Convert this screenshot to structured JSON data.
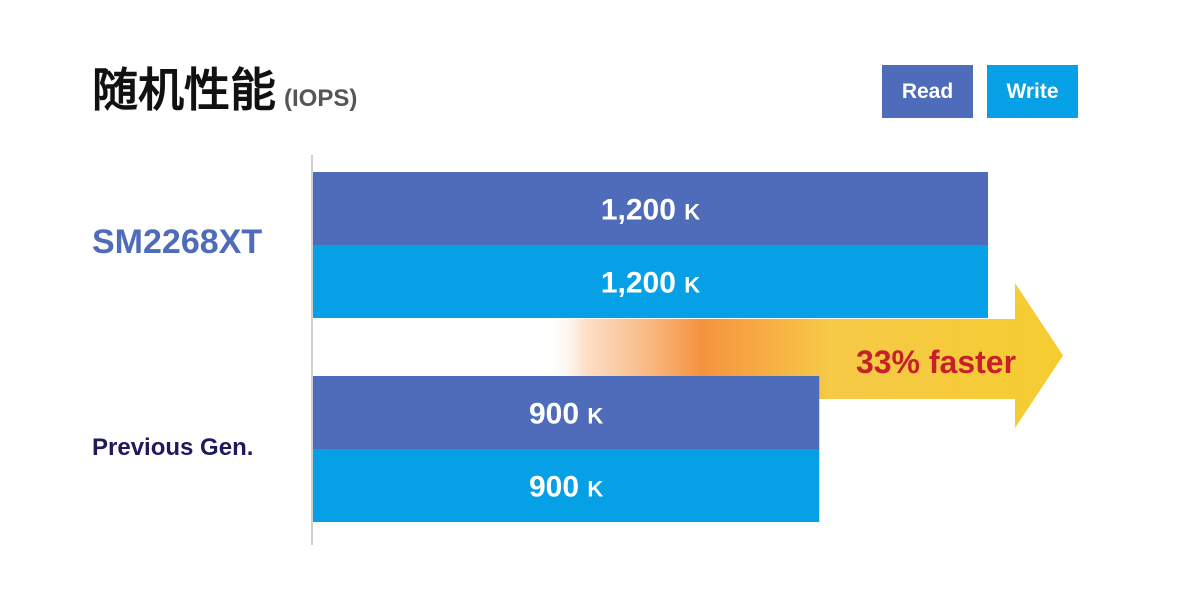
{
  "title": "随机性能",
  "title_unit": "(IOPS)",
  "legend": {
    "read_label": "Read",
    "write_label": "Write",
    "read_color": "#4e6cb9",
    "write_color": "#05a0e6"
  },
  "annotation": {
    "text": "33% faster",
    "color": "#c8202b",
    "arrow_color": "#f5cc30"
  },
  "chart_data": {
    "type": "bar",
    "orientation": "horizontal",
    "categories": [
      "SM2268XT",
      "Previous Gen."
    ],
    "series": [
      {
        "name": "Read",
        "values": [
          1200,
          900
        ],
        "labels": [
          "1,200",
          "900"
        ]
      },
      {
        "name": "Write",
        "values": [
          1200,
          900
        ],
        "labels": [
          "1,200",
          "900"
        ]
      }
    ],
    "value_unit_suffix": "K",
    "xlim": [
      0,
      1200
    ],
    "grid": false,
    "legend_position": "top-right"
  }
}
